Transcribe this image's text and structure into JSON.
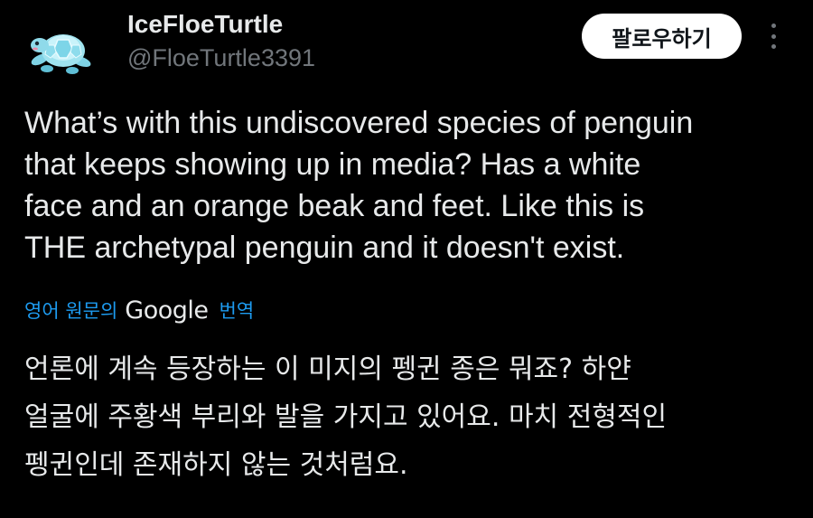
{
  "author": {
    "display_name": "IceFloeTurtle",
    "handle": "@FloeTurtle3391",
    "avatar_icon": "turtle-avatar-icon"
  },
  "actions": {
    "follow_label": "팔로우하기",
    "more_icon": "more-vertical-icon"
  },
  "tweet": {
    "text": "What’s with this undiscovered species of penguin\nthat keeps showing up in media? Has a white\nface and an orange beak and feet. Like this is\nTHE archetypal penguin and it doesn't exist."
  },
  "translation": {
    "prefix": "영어 원문의",
    "provider": "Google",
    "suffix": "번역",
    "text": "언론에 계속 등장하는 이 미지의 펭귄 종은 뭐죠? 하얀\n얼굴에 주황색 부리와 발을 가지고 있어요. 마치 전형적인\n펭귄인데 존재하지 않는 것처럼요."
  },
  "colors": {
    "background": "#000000",
    "text_primary": "#e7e9ea",
    "text_secondary": "#71767b",
    "link": "#1d9bf0",
    "button_bg": "#ffffff"
  }
}
